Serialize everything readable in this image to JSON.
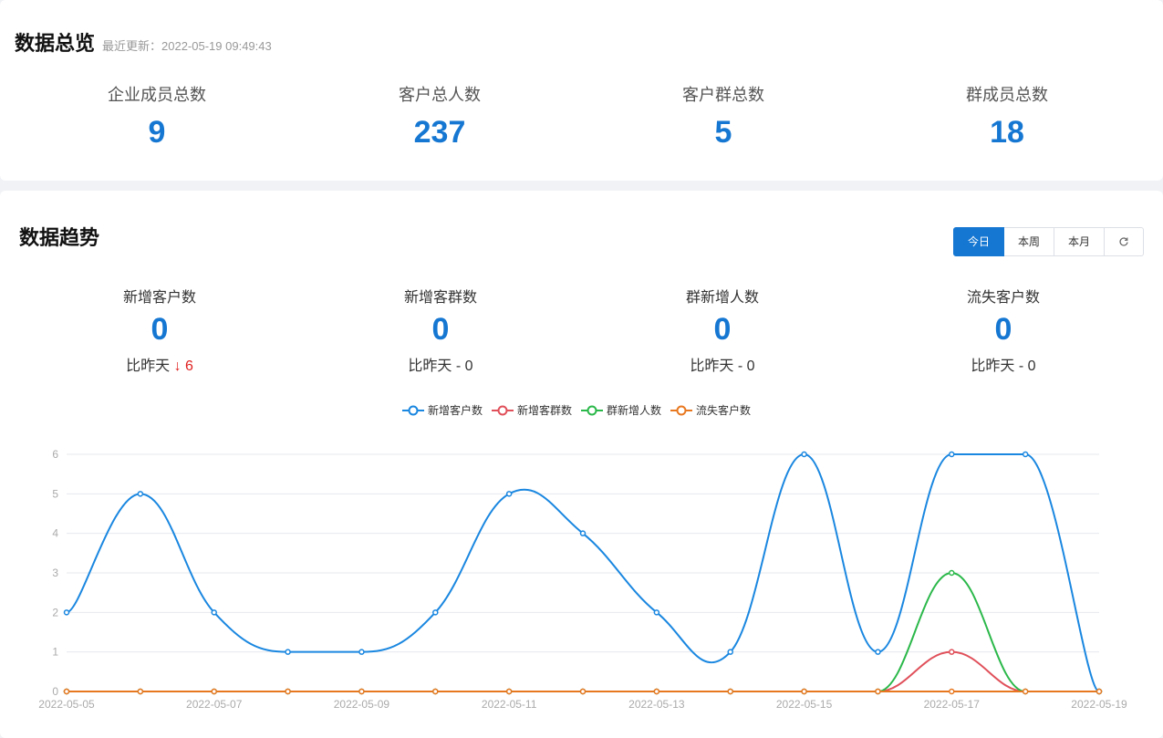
{
  "overview": {
    "title": "数据总览",
    "updated": "最近更新：2022-05-19 09:49:43",
    "stats": [
      {
        "label": "企业成员总数",
        "value": "9"
      },
      {
        "label": "客户总人数",
        "value": "237"
      },
      {
        "label": "客户群总数",
        "value": "5"
      },
      {
        "label": "群成员总数",
        "value": "18"
      }
    ]
  },
  "trend": {
    "title": "数据趋势",
    "buttons": [
      "今日",
      "本周",
      "本月"
    ],
    "refresh_icon": "refresh-icon",
    "stats": [
      {
        "label": "新增客户数",
        "value": "0",
        "compare_prefix": "比昨天",
        "compare_value": "↓ 6",
        "down": true
      },
      {
        "label": "新增客群数",
        "value": "0",
        "compare_prefix": "比昨天",
        "compare_value": "- 0",
        "down": false
      },
      {
        "label": "群新增人数",
        "value": "0",
        "compare_prefix": "比昨天",
        "compare_value": "- 0",
        "down": false
      },
      {
        "label": "流失客户数",
        "value": "0",
        "compare_prefix": "比昨天",
        "compare_value": "- 0",
        "down": false
      }
    ]
  },
  "chart_data": {
    "type": "line",
    "x": [
      "2022-05-05",
      "2022-05-06",
      "2022-05-07",
      "2022-05-08",
      "2022-05-09",
      "2022-05-10",
      "2022-05-11",
      "2022-05-12",
      "2022-05-13",
      "2022-05-14",
      "2022-05-15",
      "2022-05-16",
      "2022-05-17",
      "2022-05-18",
      "2022-05-19"
    ],
    "x_tick_labels": [
      "2022-05-05",
      "2022-05-07",
      "2022-05-09",
      "2022-05-11",
      "2022-05-13",
      "2022-05-15",
      "2022-05-17",
      "2022-05-19"
    ],
    "ylim": [
      0,
      6
    ],
    "y_ticks": [
      0,
      1,
      2,
      3,
      4,
      5,
      6
    ],
    "grid": true,
    "legend_position": "top-center",
    "series": [
      {
        "name": "新增客户数",
        "color": "#1a87e0",
        "values": [
          2,
          5,
          2,
          1,
          1,
          2,
          5,
          4,
          2,
          1,
          6,
          1,
          6,
          6,
          0
        ]
      },
      {
        "name": "新增客群数",
        "color": "#e0505a",
        "values": [
          0,
          0,
          0,
          0,
          0,
          0,
          0,
          0,
          0,
          0,
          0,
          0,
          1,
          0,
          0
        ]
      },
      {
        "name": "群新增人数",
        "color": "#2bb84a",
        "values": [
          0,
          0,
          0,
          0,
          0,
          0,
          0,
          0,
          0,
          0,
          0,
          0,
          3,
          0,
          0
        ]
      },
      {
        "name": "流失客户数",
        "color": "#e87820",
        "values": [
          0,
          0,
          0,
          0,
          0,
          0,
          0,
          0,
          0,
          0,
          0,
          0,
          0,
          0,
          0
        ]
      }
    ]
  }
}
